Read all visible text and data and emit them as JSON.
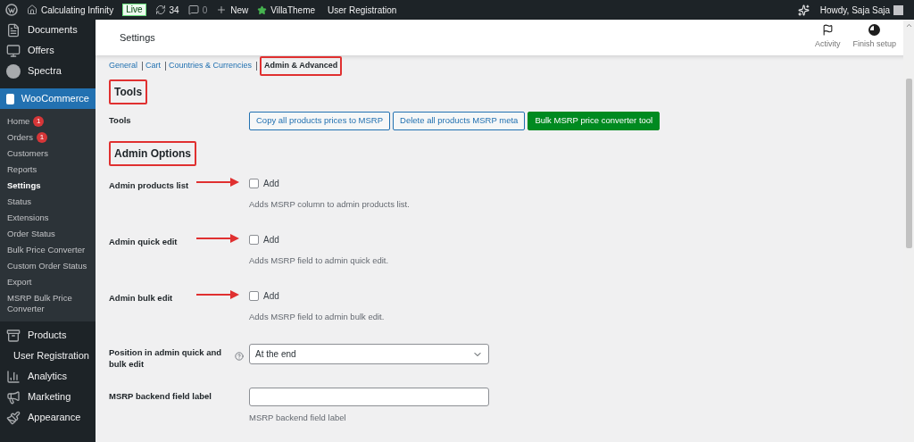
{
  "admin_bar": {
    "site": "Calculating Infinity",
    "live_badge": "Live",
    "updates": "34",
    "comments": "0",
    "new": "New",
    "links": [
      "VillaTheme",
      "User Registration"
    ],
    "greeting": "Howdy, Saja Saja"
  },
  "sidebar": {
    "top_items": [
      {
        "label": "Documents"
      },
      {
        "label": "Offers"
      },
      {
        "label": "Spectra"
      }
    ],
    "current": {
      "label": "WooCommerce"
    },
    "submenu": [
      {
        "label": "Home",
        "selected": false,
        "badge": "1"
      },
      {
        "label": "Orders",
        "selected": false,
        "badge": "1"
      },
      {
        "label": "Customers",
        "selected": false
      },
      {
        "label": "Reports",
        "selected": false
      },
      {
        "label": "Settings",
        "selected": true
      },
      {
        "label": "Status",
        "selected": false
      },
      {
        "label": "Extensions",
        "selected": false
      },
      {
        "label": "Order Status",
        "selected": false
      },
      {
        "label": "Bulk Price Converter",
        "selected": false
      },
      {
        "label": "Custom Order Status",
        "selected": false
      },
      {
        "label": "Export",
        "selected": false
      },
      {
        "label": "MSRP Bulk Price Converter",
        "selected": false
      }
    ],
    "bottom_items": [
      {
        "label": "Products"
      },
      {
        "label": "User Registration"
      },
      {
        "label": "Analytics"
      },
      {
        "label": "Marketing"
      },
      {
        "label": "Appearance"
      }
    ]
  },
  "header": {
    "title": "Settings",
    "actions": [
      {
        "label": "Activity"
      },
      {
        "label": "Finish setup"
      }
    ]
  },
  "tabs": [
    {
      "label": "General",
      "selected": false,
      "highlighted": false
    },
    {
      "label": "Cart",
      "selected": false,
      "highlighted": false
    },
    {
      "label": "Countries & Currencies",
      "selected": false,
      "highlighted": false
    },
    {
      "label": "Admin & Advanced",
      "selected": true,
      "highlighted": true
    }
  ],
  "sections": [
    {
      "heading": "Tools",
      "highlighted": true,
      "rows": [
        {
          "kind": "buttons",
          "label": "Tools",
          "buttons": [
            {
              "label": "Copy all products prices to MSRP",
              "primary": false
            },
            {
              "label": "Delete all products MSRP meta",
              "primary": false
            },
            {
              "label": "Bulk MSRP price converter tool",
              "primary": true
            }
          ]
        }
      ]
    },
    {
      "heading": "Admin Options",
      "highlighted": true,
      "rows": [
        {
          "kind": "checkbox",
          "label": "Admin products list",
          "checkbox_label": "Add",
          "checked": false,
          "description": "Adds MSRP column to admin products list.",
          "arrow": true
        },
        {
          "kind": "checkbox",
          "label": "Admin quick edit",
          "checkbox_label": "Add",
          "checked": false,
          "description": "Adds MSRP field to admin quick edit.",
          "arrow": true
        },
        {
          "kind": "checkbox",
          "label": "Admin bulk edit",
          "checkbox_label": "Add",
          "checked": false,
          "description": "Adds MSRP field to admin bulk edit.",
          "arrow": true
        },
        {
          "kind": "select",
          "label": "Position in admin quick and bulk edit",
          "help": true,
          "value": "At the end"
        },
        {
          "kind": "text",
          "label": "MSRP backend field label",
          "description": "MSRP backend field label"
        }
      ]
    }
  ]
}
